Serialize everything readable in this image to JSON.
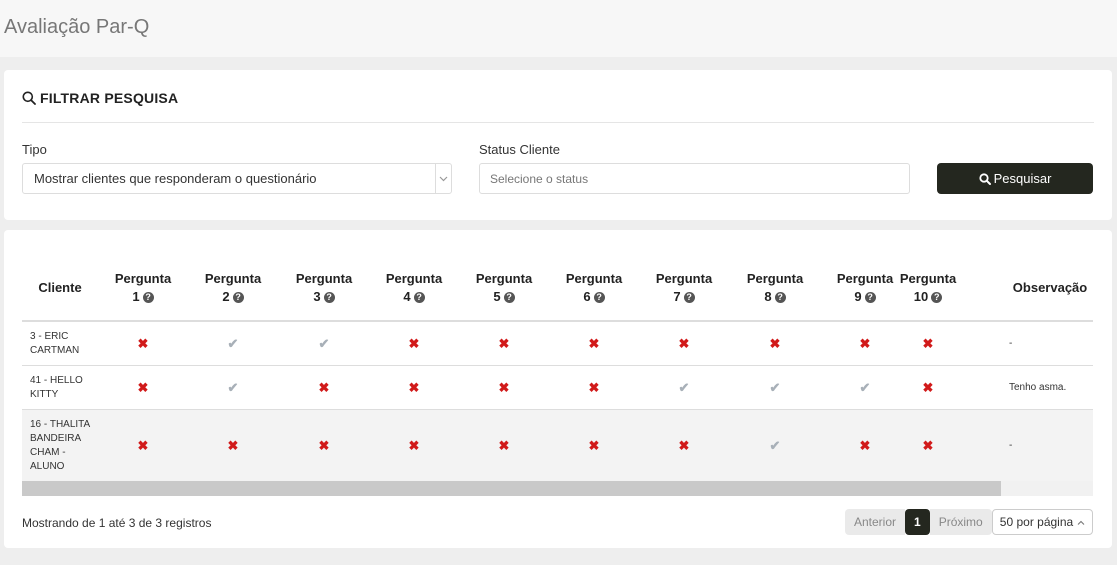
{
  "page": {
    "title": "Avaliação Par-Q"
  },
  "filter": {
    "heading": "FILTRAR PESQUISA",
    "tipo_label": "Tipo",
    "tipo_value": "Mostrar clientes que responderam o questionário",
    "status_label": "Status Cliente",
    "status_placeholder": "Selecione o status",
    "search_button": "Pesquisar"
  },
  "table": {
    "col_client": "Cliente",
    "col_obs": "Observação",
    "question_word": "Pergunta",
    "questions": [
      "1",
      "2",
      "3",
      "4",
      "5",
      "6",
      "7",
      "8",
      "9",
      "10"
    ],
    "rows": [
      {
        "client": "3 - ERIC\nCARTMAN",
        "answers": [
          "no",
          "yes",
          "yes",
          "no",
          "no",
          "no",
          "no",
          "no",
          "no",
          "no"
        ],
        "obs": "-"
      },
      {
        "client": "41 - HELLO\nKITTY",
        "answers": [
          "no",
          "yes",
          "no",
          "no",
          "no",
          "no",
          "yes",
          "yes",
          "yes",
          "no"
        ],
        "obs": "Tenho asma."
      },
      {
        "client": "16 - THALITA\nBANDEIRA\nCHAM -\nALUNO",
        "answers": [
          "no",
          "no",
          "no",
          "no",
          "no",
          "no",
          "no",
          "yes",
          "no",
          "no"
        ],
        "obs": "-"
      }
    ]
  },
  "footer": {
    "info": "Mostrando de 1 até 3 de 3 registros",
    "prev": "Anterior",
    "page": "1",
    "next": "Próximo",
    "per_page": "50 por página"
  },
  "icons": {
    "no": "✖",
    "yes": "✔",
    "help": "?"
  },
  "colors": {
    "accent": "#24271f",
    "no_mark": "#d11a1a",
    "yes_mark": "#a8b0b8"
  }
}
